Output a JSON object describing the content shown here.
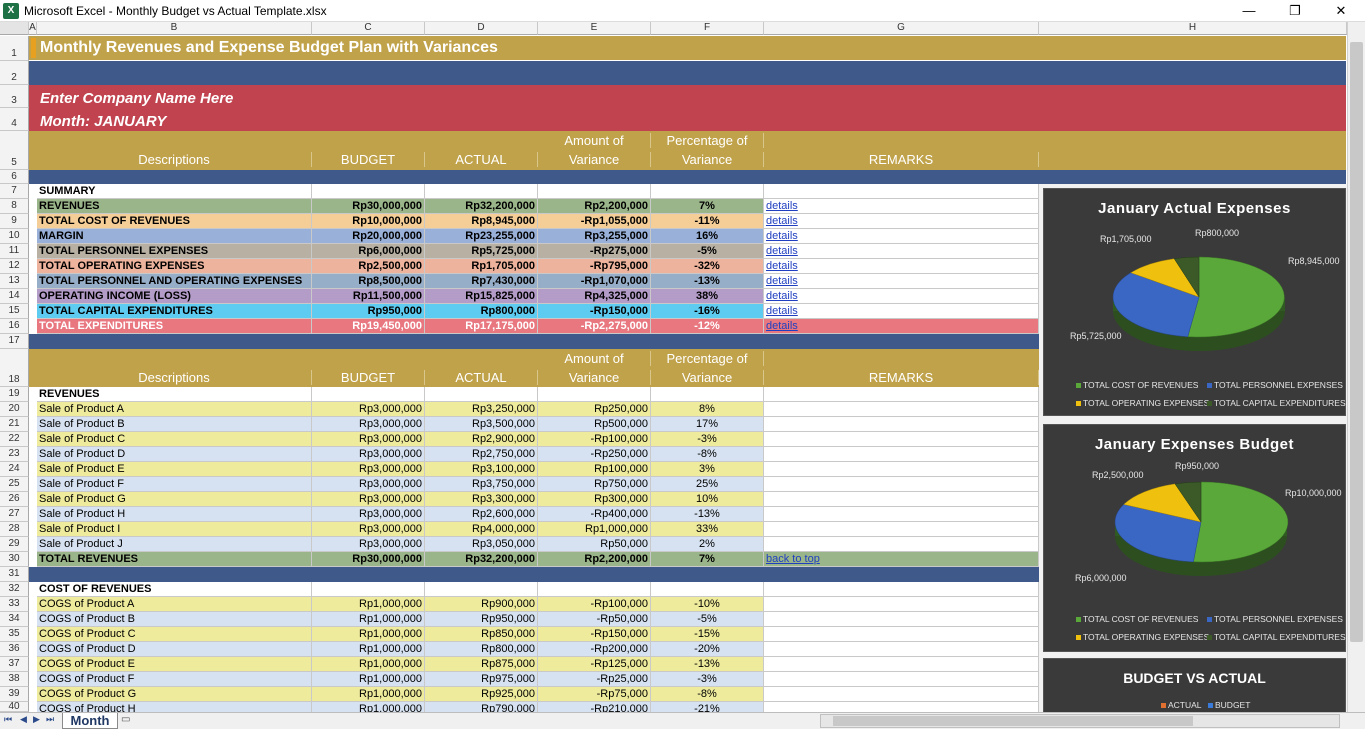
{
  "window": {
    "title": "Microsoft Excel - Monthly Budget vs Actual Template.xlsx",
    "app_icon": "excel-icon",
    "minimize": "—",
    "restore": "❐",
    "close": "✕"
  },
  "columns": [
    "A",
    "B",
    "C",
    "D",
    "E",
    "F",
    "G",
    "H"
  ],
  "rows": [
    "1",
    "2",
    "3",
    "4",
    "5",
    "6",
    "7",
    "8",
    "9",
    "10",
    "11",
    "12",
    "13",
    "14",
    "15",
    "16",
    "17",
    "18",
    "19",
    "20",
    "21",
    "22",
    "23",
    "24",
    "25",
    "26",
    "27",
    "28",
    "29",
    "30",
    "31",
    "32",
    "33",
    "34",
    "35",
    "36",
    "37",
    "38",
    "39",
    "40"
  ],
  "sheet": {
    "title": "Monthly Revenues and Expense Budget Plan with Variances",
    "company": "Enter Company Name Here",
    "month": "Month: JANUARY",
    "headers": {
      "descriptions": "Descriptions",
      "budget": "BUDGET",
      "actual": "ACTUAL",
      "amount_l1": "Amount of",
      "amount_l2": "Variance",
      "pct_l1": "Percentage of",
      "pct_l2": "Variance",
      "remarks": "REMARKS"
    },
    "summary_label": "SUMMARY",
    "summary": [
      {
        "desc": "REVENUES",
        "budget": "Rp30,000,000",
        "actual": "Rp32,200,000",
        "var": "Rp2,200,000",
        "pct": "7%",
        "remark": "details"
      },
      {
        "desc": "TOTAL COST OF REVENUES",
        "budget": "Rp10,000,000",
        "actual": "Rp8,945,000",
        "var": "-Rp1,055,000",
        "pct": "-11%",
        "remark": "details"
      },
      {
        "desc": "MARGIN",
        "budget": "Rp20,000,000",
        "actual": "Rp23,255,000",
        "var": "Rp3,255,000",
        "pct": "16%",
        "remark": "details"
      },
      {
        "desc": "TOTAL PERSONNEL EXPENSES",
        "budget": "Rp6,000,000",
        "actual": "Rp5,725,000",
        "var": "-Rp275,000",
        "pct": "-5%",
        "remark": "details"
      },
      {
        "desc": "TOTAL OPERATING EXPENSES",
        "budget": "Rp2,500,000",
        "actual": "Rp1,705,000",
        "var": "-Rp795,000",
        "pct": "-32%",
        "remark": "details"
      },
      {
        "desc": "TOTAL PERSONNEL AND OPERATING EXPENSES",
        "budget": "Rp8,500,000",
        "actual": "Rp7,430,000",
        "var": "-Rp1,070,000",
        "pct": "-13%",
        "remark": "details"
      },
      {
        "desc": "OPERATING INCOME (LOSS)",
        "budget": "Rp11,500,000",
        "actual": "Rp15,825,000",
        "var": "Rp4,325,000",
        "pct": "38%",
        "remark": "details"
      },
      {
        "desc": "TOTAL CAPITAL EXPENDITURES",
        "budget": "Rp950,000",
        "actual": "Rp800,000",
        "var": "-Rp150,000",
        "pct": "-16%",
        "remark": "details"
      },
      {
        "desc": "TOTAL EXPENDITURES",
        "budget": "Rp19,450,000",
        "actual": "Rp17,175,000",
        "var": "-Rp2,275,000",
        "pct": "-12%",
        "remark": "details"
      }
    ],
    "revenues_label": "REVENUES",
    "revenues": [
      {
        "desc": "Sale of Product A",
        "budget": "Rp3,000,000",
        "actual": "Rp3,250,000",
        "var": "Rp250,000",
        "pct": "8%"
      },
      {
        "desc": "Sale of Product B",
        "budget": "Rp3,000,000",
        "actual": "Rp3,500,000",
        "var": "Rp500,000",
        "pct": "17%"
      },
      {
        "desc": "Sale of Product C",
        "budget": "Rp3,000,000",
        "actual": "Rp2,900,000",
        "var": "-Rp100,000",
        "pct": "-3%"
      },
      {
        "desc": "Sale of Product D",
        "budget": "Rp3,000,000",
        "actual": "Rp2,750,000",
        "var": "-Rp250,000",
        "pct": "-8%"
      },
      {
        "desc": "Sale of Product E",
        "budget": "Rp3,000,000",
        "actual": "Rp3,100,000",
        "var": "Rp100,000",
        "pct": "3%"
      },
      {
        "desc": "Sale of Product F",
        "budget": "Rp3,000,000",
        "actual": "Rp3,750,000",
        "var": "Rp750,000",
        "pct": "25%"
      },
      {
        "desc": "Sale of Product G",
        "budget": "Rp3,000,000",
        "actual": "Rp3,300,000",
        "var": "Rp300,000",
        "pct": "10%"
      },
      {
        "desc": "Sale of Product H",
        "budget": "Rp3,000,000",
        "actual": "Rp2,600,000",
        "var": "-Rp400,000",
        "pct": "-13%"
      },
      {
        "desc": "Sale of Product I",
        "budget": "Rp3,000,000",
        "actual": "Rp4,000,000",
        "var": "Rp1,000,000",
        "pct": "33%"
      },
      {
        "desc": "Sale of Product J",
        "budget": "Rp3,000,000",
        "actual": "Rp3,050,000",
        "var": "Rp50,000",
        "pct": "2%"
      }
    ],
    "total_revenues": {
      "desc": "TOTAL REVENUES",
      "budget": "Rp30,000,000",
      "actual": "Rp32,200,000",
      "var": "Rp2,200,000",
      "pct": "7%",
      "remark": "back to top"
    },
    "cogs_label": "COST OF REVENUES",
    "cogs": [
      {
        "desc": "COGS of Product A",
        "budget": "Rp1,000,000",
        "actual": "Rp900,000",
        "var": "-Rp100,000",
        "pct": "-10%"
      },
      {
        "desc": "COGS of Product B",
        "budget": "Rp1,000,000",
        "actual": "Rp950,000",
        "var": "-Rp50,000",
        "pct": "-5%"
      },
      {
        "desc": "COGS of Product C",
        "budget": "Rp1,000,000",
        "actual": "Rp850,000",
        "var": "-Rp150,000",
        "pct": "-15%"
      },
      {
        "desc": "COGS of Product D",
        "budget": "Rp1,000,000",
        "actual": "Rp800,000",
        "var": "-Rp200,000",
        "pct": "-20%"
      },
      {
        "desc": "COGS of Product E",
        "budget": "Rp1,000,000",
        "actual": "Rp875,000",
        "var": "-Rp125,000",
        "pct": "-13%"
      },
      {
        "desc": "COGS of Product F",
        "budget": "Rp1,000,000",
        "actual": "Rp975,000",
        "var": "-Rp25,000",
        "pct": "-3%"
      },
      {
        "desc": "COGS of Product G",
        "budget": "Rp1,000,000",
        "actual": "Rp925,000",
        "var": "-Rp75,000",
        "pct": "-8%"
      },
      {
        "desc": "COGS of Product H",
        "budget": "Rp1,000,000",
        "actual": "Rp790,000",
        "var": "-Rp210,000",
        "pct": "-21%"
      }
    ]
  },
  "colors": {
    "gold": "#c0a24a",
    "navy": "#3f5a8a",
    "red": "#c0434f",
    "row_yellow": "#eeeb9c",
    "row_blue": "#d6e2f1",
    "revenue_green": "#9bb58a",
    "cogs_tan": "#f4cd97",
    "margin_blue": "#99b0d9",
    "personnel_gray": "#b7b0a3",
    "operating_peach": "#eeb39c",
    "pno_steel": "#97aec9",
    "income_purple": "#b49cc8",
    "capex_cyan": "#5ecbf0",
    "totalexp_pink": "#e87780",
    "pie_green": "#5aa83a",
    "pie_blue": "#3a66c4",
    "pie_yellow": "#efc10e",
    "pie_darkgreen": "#3c5a28"
  },
  "charts": {
    "actual": {
      "title": "January Actual Expenses",
      "labels": [
        "Rp8,945,000",
        "Rp5,725,000",
        "Rp1,705,000",
        "Rp800,000"
      ],
      "legend": [
        "TOTAL COST OF REVENUES",
        "TOTAL PERSONNEL EXPENSES",
        "TOTAL OPERATING EXPENSES",
        "TOTAL CAPITAL EXPENDITURES"
      ]
    },
    "budget": {
      "title": "January Expenses Budget",
      "labels": [
        "Rp10,000,000",
        "Rp6,000,000",
        "Rp2,500,000",
        "Rp950,000"
      ],
      "legend": [
        "TOTAL COST OF REVENUES",
        "TOTAL PERSONNEL EXPENSES",
        "TOTAL OPERATING EXPENSES",
        "TOTAL CAPITAL EXPENDITURES"
      ]
    },
    "bva": {
      "title": "BUDGET VS ACTUAL",
      "legend": [
        "ACTUAL",
        "BUDGET"
      ]
    }
  },
  "chart_data": [
    {
      "type": "pie",
      "title": "January Actual Expenses",
      "categories": [
        "TOTAL COST OF REVENUES",
        "TOTAL PERSONNEL EXPENSES",
        "TOTAL OPERATING EXPENSES",
        "TOTAL CAPITAL EXPENDITURES"
      ],
      "values": [
        8945000,
        5725000,
        1705000,
        800000
      ],
      "legend": "bottom"
    },
    {
      "type": "pie",
      "title": "January Expenses Budget",
      "categories": [
        "TOTAL COST OF REVENUES",
        "TOTAL PERSONNEL EXPENSES",
        "TOTAL OPERATING EXPENSES",
        "TOTAL CAPITAL EXPENDITURES"
      ],
      "values": [
        10000000,
        6000000,
        2500000,
        950000
      ],
      "legend": "bottom"
    }
  ],
  "tabs": {
    "active": "Month",
    "nav": [
      "⏮",
      "◀",
      "▶",
      "⏭"
    ]
  }
}
